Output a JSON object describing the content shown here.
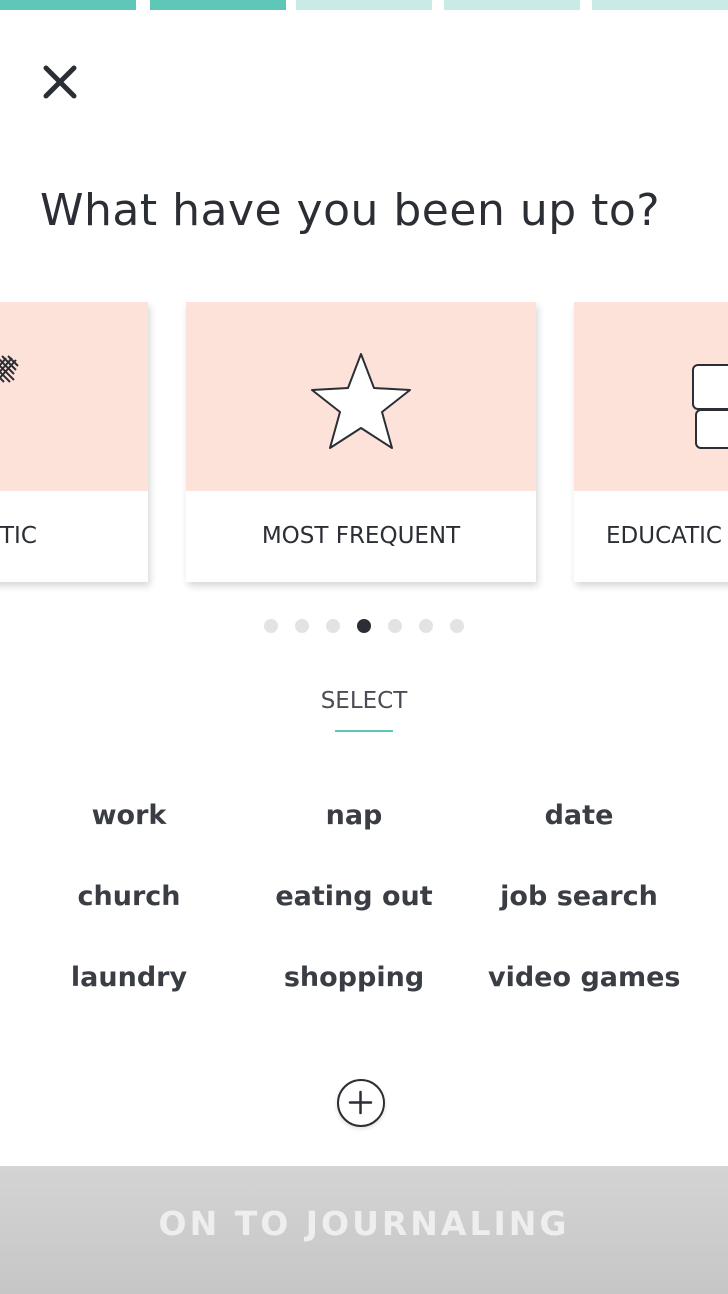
{
  "progress": {
    "completed_color": "#5ec7b8",
    "pending_color": "#c8ebe6",
    "segments": [
      "completed",
      "completed",
      "pending",
      "pending",
      "pending"
    ]
  },
  "header": {
    "close_icon": "close-icon",
    "title": "What have you been up to?"
  },
  "carousel": {
    "card_top_color": "#fde2da",
    "cards": [
      {
        "label": "TIC",
        "icon": "partial-icon"
      },
      {
        "label": "MOST FREQUENT",
        "icon": "star-icon"
      },
      {
        "label": "EDUCATIC",
        "icon": "book-icon"
      }
    ],
    "dot_count": 7,
    "active_dot": 4
  },
  "select": {
    "tab_label": "SELECT",
    "underline_color": "#5ec7b8"
  },
  "activities": [
    "work",
    "nap",
    "date",
    "church",
    "eating out",
    "job search",
    "laundry",
    "shopping",
    "video games"
  ],
  "add_button": {
    "icon": "plus-icon"
  },
  "footer": {
    "button_label": "ON TO JOURNALING",
    "text_color": "#eeeeee"
  }
}
